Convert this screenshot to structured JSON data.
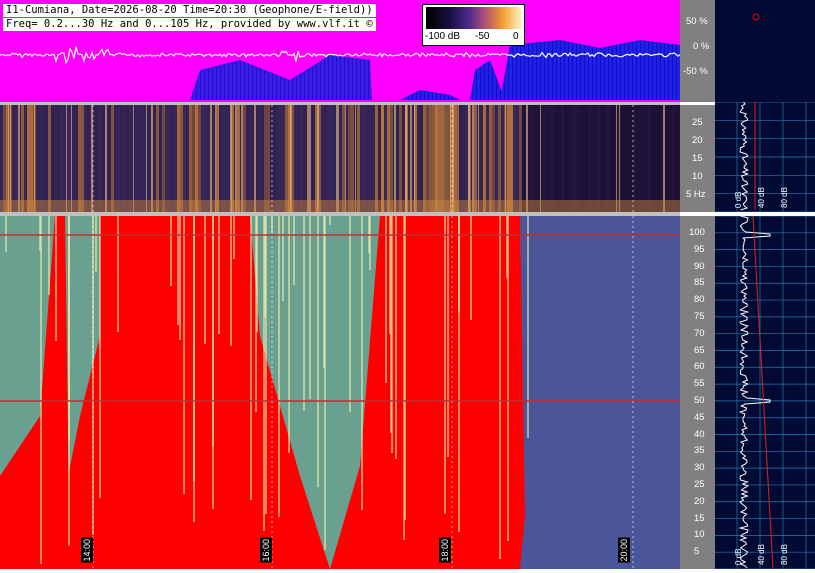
{
  "header": {
    "line1": "I1-Cumiana, Date=2026-08-20 Time=20:30 (Geophone/E-field))",
    "line2": "Freq= 0.2...30 Hz and 0...105 Hz, provided by www.vlf.it ©"
  },
  "colorbar": {
    "ticks": [
      "-100 dB",
      "-50",
      "0"
    ]
  },
  "chart_data": [
    {
      "type": "area",
      "panel": "amplitude",
      "y_ticks": [
        "50 %",
        "0 %",
        "-50 %"
      ],
      "ylim": [
        -100,
        100
      ]
    },
    {
      "type": "heatmap",
      "panel": "spectrogram-low",
      "y_ticks": [
        "25",
        "20",
        "15",
        "10",
        "5 Hz"
      ],
      "ylim": [
        0.2,
        30
      ]
    },
    {
      "type": "heatmap",
      "panel": "spectrogram-high",
      "y_ticks": [
        "100",
        "95",
        "90",
        "85",
        "80",
        "75",
        "70",
        "65",
        "60",
        "55",
        "50",
        "45",
        "40",
        "35",
        "30",
        "25",
        "20",
        "15",
        "10",
        "5"
      ],
      "ylim": [
        0,
        105
      ],
      "x_ticks": [
        "14:00",
        "16:00",
        "18:00",
        "20:00"
      ]
    }
  ],
  "side_labels": {
    "top_panel_axis": [
      "0 dB",
      "40 dB",
      "80 dB"
    ],
    "bottom_panel_axis": [
      "0 dB",
      "40 dB",
      "80 dB"
    ]
  },
  "colors": {
    "magenta": "#ff00ff",
    "blue": "#1515e0",
    "red": "#ff0000",
    "teal": "#5a9a8a",
    "navy": "#3a3a8a",
    "panel_bg": "#000a33",
    "grid": "#3399cc"
  }
}
